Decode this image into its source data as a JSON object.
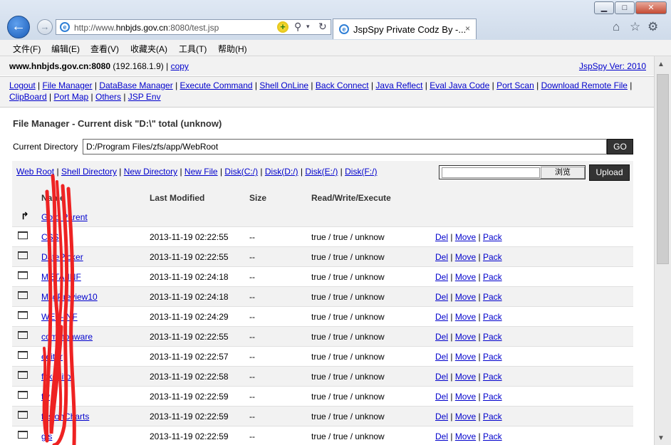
{
  "browser": {
    "url_prefix": "http://www.",
    "url_host": "hnbjds.gov.cn",
    "url_suffix": ":8080/test.jsp",
    "tab_title": "JspSpy Private Codz By -...",
    "tab_close": "×",
    "window_controls": [
      "minimize",
      "maximize",
      "close"
    ]
  },
  "menu": [
    "文件(F)",
    "编辑(E)",
    "查看(V)",
    "收藏夹(A)",
    "工具(T)",
    "帮助(H)"
  ],
  "header": {
    "host": "www.hnbjds.gov.cn:8080",
    "ip": "(192.168.1.9)",
    "separator": "|",
    "copy": "copy",
    "version": "JspSpy Ver: 2010"
  },
  "nav": [
    "Logout",
    "File Manager",
    "DataBase Manager",
    "Execute Command",
    "Shell OnLine",
    "Back Connect",
    "Java Reflect",
    "Eval Java Code",
    "Port Scan",
    "Download Remote File",
    "ClipBoard",
    "Port Map",
    "Others",
    "JSP Env"
  ],
  "file_manager": {
    "title": "File Manager - Current disk \"D:\\\" total (unknow)",
    "cd_label": "Current Directory",
    "cd_value": "D:/Program Files/zfs/app/WebRoot",
    "go": "GO",
    "quick_links": [
      "Web Root",
      "Shell Directory",
      "New Directory",
      "New File",
      "Disk(C:/)",
      "Disk(D:/)",
      "Disk(E:/)",
      "Disk(F:/)"
    ],
    "browse": "浏览",
    "upload": "Upload"
  },
  "table": {
    "headers": [
      "Name",
      "Last Modified",
      "Size",
      "Read/Write/Execute"
    ],
    "parent": "Goto Parent",
    "actions": [
      "Del",
      "Move",
      "Pack"
    ],
    "rows": [
      {
        "name": "CSS",
        "date": "2013-11-19 02:22:55",
        "size": "--",
        "rwx": "true / true / unknow"
      },
      {
        "name": "DatePicker",
        "date": "2013-11-19 02:22:55",
        "size": "--",
        "rwx": "true / true / unknow"
      },
      {
        "name": "META-INF",
        "date": "2013-11-19 02:24:18",
        "size": "--",
        "rwx": "true / true / unknow"
      },
      {
        "name": "MsgPreview10",
        "date": "2013-11-19 02:24:18",
        "size": "--",
        "rwx": "true / true / unknow"
      },
      {
        "name": "WEB-INF",
        "date": "2013-11-19 02:24:29",
        "size": "--",
        "rwx": "true / true / unknow"
      },
      {
        "name": "commonware",
        "date": "2013-11-19 02:22:55",
        "size": "--",
        "rwx": "true / true / unknow"
      },
      {
        "name": "editor",
        "date": "2013-11-19 02:22:57",
        "size": "--",
        "rwx": "true / true / unknow"
      },
      {
        "name": "fckeditor",
        "date": "2013-11-19 02:22:58",
        "size": "--",
        "rwx": "true / true / unknow"
      },
      {
        "name": "flv",
        "date": "2013-11-19 02:22:59",
        "size": "--",
        "rwx": "true / true / unknow"
      },
      {
        "name": "fusionCharts",
        "date": "2013-11-19 02:22:59",
        "size": "--",
        "rwx": "true / true / unknow"
      },
      {
        "name": "gis",
        "date": "2013-11-19 02:22:59",
        "size": "--",
        "rwx": "true / true / unknow"
      }
    ]
  },
  "colors": {
    "link": "#0000cc",
    "scribble": "#ee2222",
    "dark_button": "#333333",
    "panel": "#f2f2f2"
  }
}
